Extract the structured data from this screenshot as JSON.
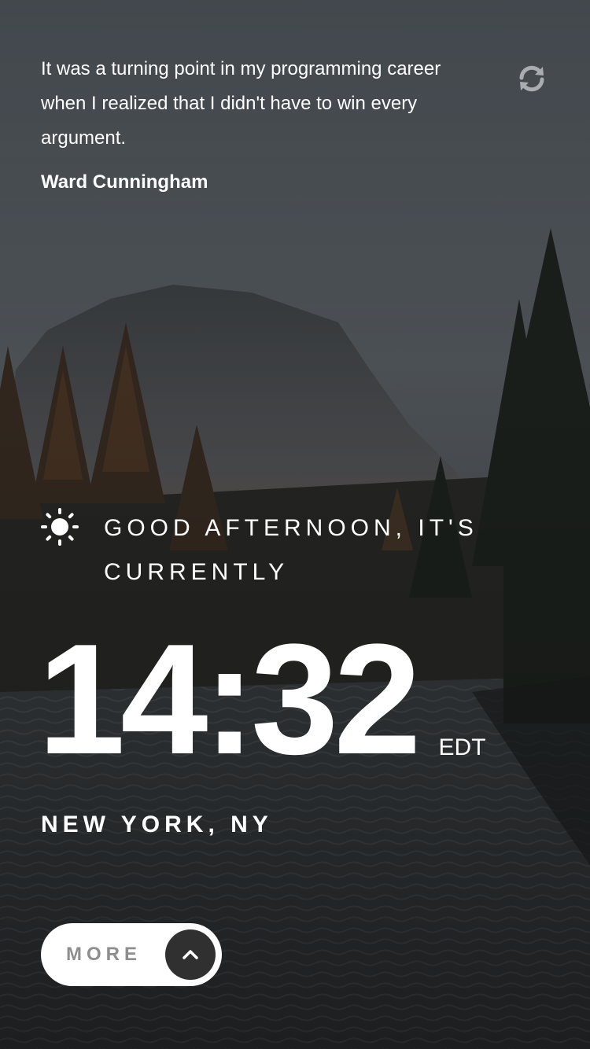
{
  "quote": {
    "text": "It was a turning point in my programming career when I realized that I didn't have to win every argument.",
    "author": "Ward Cunningham",
    "refresh_icon": "refresh-icon"
  },
  "greeting": {
    "icon": "sun-icon",
    "text": "GOOD AFTERNOON, IT'S CURRENTLY"
  },
  "clock": {
    "time": "14:32",
    "timezone": "EDT"
  },
  "location": "NEW YORK, NY",
  "more_button": {
    "label": "MORE",
    "icon": "chevron-up-icon"
  },
  "colors": {
    "text": "#ffffff",
    "button_bg": "#ffffff",
    "button_label": "#8e8e8e",
    "button_circle": "#303030"
  }
}
